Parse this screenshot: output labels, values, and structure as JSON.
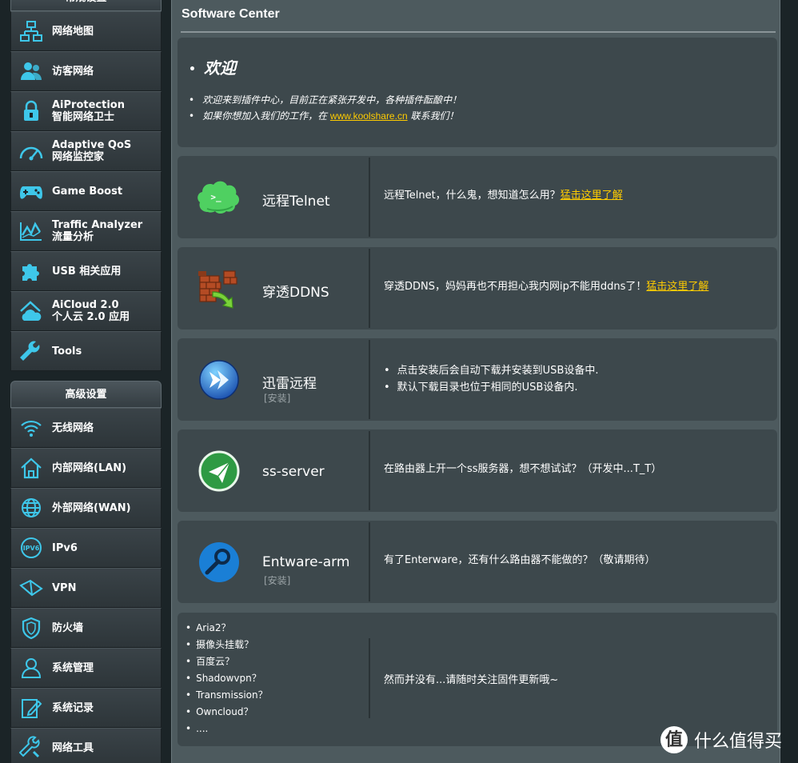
{
  "sidebar": {
    "general_title": "常规设置",
    "general_items": [
      {
        "label": "网络地图",
        "icon": "network-map-icon"
      },
      {
        "label": "访客网络",
        "icon": "guest-network-icon"
      },
      {
        "label": "AiProtection\n智能网络卫士",
        "icon": "lock-icon"
      },
      {
        "label": "Adaptive QoS\n网络监控家",
        "icon": "speedometer-icon"
      },
      {
        "label": "Game Boost",
        "icon": "gamepad-icon"
      },
      {
        "label": "Traffic Analyzer\n流量分析",
        "icon": "traffic-chart-icon"
      },
      {
        "label": "USB 相关应用",
        "icon": "puzzle-icon"
      },
      {
        "label": "AiCloud 2.0\n个人云 2.0 应用",
        "icon": "cloud-home-icon"
      },
      {
        "label": "Tools",
        "icon": "wrench-icon"
      }
    ],
    "advanced_title": "高级设置",
    "advanced_items": [
      {
        "label": "无线网络",
        "icon": "wifi-icon"
      },
      {
        "label": "内部网络(LAN)",
        "icon": "home-icon"
      },
      {
        "label": "外部网络(WAN)",
        "icon": "globe-icon"
      },
      {
        "label": "IPv6",
        "icon": "ipv6-icon"
      },
      {
        "label": "VPN",
        "icon": "vpn-icon"
      },
      {
        "label": "防火墙",
        "icon": "shield-icon"
      },
      {
        "label": "系统管理",
        "icon": "user-admin-icon"
      },
      {
        "label": "系统记录",
        "icon": "log-edit-icon"
      },
      {
        "label": "网络工具",
        "icon": "tools-icon"
      }
    ]
  },
  "main": {
    "title": "Software Center",
    "welcome": {
      "heading": "欢迎",
      "line1": "欢迎来到插件中心，目前正在紧张开发中，各种插件酝酿中！",
      "line2_prefix": "如果你想加入我们的工作，在 ",
      "line2_link": "www.koolshare.cn",
      "line2_suffix": " 联系我们！"
    },
    "plugins": [
      {
        "name": "远程Telnet",
        "status": "",
        "desc": "远程Telnet，什么鬼，想知道怎么用？",
        "link": "猛击这里了解",
        "icon": "telnet-icon"
      },
      {
        "name": "穿透DDNS",
        "status": "",
        "desc": "穿透DDNS，妈妈再也不用担心我内网ip不能用ddns了！",
        "link": "猛击这里了解",
        "icon": "firewall-bricks-icon"
      },
      {
        "name": "迅雷远程",
        "status": "[安装]",
        "bullets": [
          "点击安装后会自动下载并安装到USB设备中.",
          "默认下载目录也位于相同的USB设备内."
        ],
        "icon": "xunlei-icon"
      },
      {
        "name": "ss-server",
        "status": "",
        "desc": "在路由器上开一个ss服务器，想不想试试？（开发中...T_T）",
        "icon": "paper-plane-icon"
      },
      {
        "name": "Entware-arm",
        "status": "[安装]",
        "desc": "有了Enterware，还有什么路由器不能做的？（敬请期待）",
        "icon": "entware-icon"
      }
    ],
    "misc": {
      "items": [
        "Aria2？",
        "摄像头挂载？",
        "百度云？",
        "Shadowvpn？",
        "Transmission？",
        "Owncloud？",
        "...."
      ],
      "desc": "然而并没有...请随时关注固件更新哦~"
    }
  },
  "watermark": {
    "badge": "值",
    "text": "什么值得买"
  },
  "colors": {
    "accent_link": "#ffcc00",
    "icon_cyan": "#3ec7ea",
    "panel_bg": "#4d5a5e",
    "card_bg": "#3d484c"
  }
}
